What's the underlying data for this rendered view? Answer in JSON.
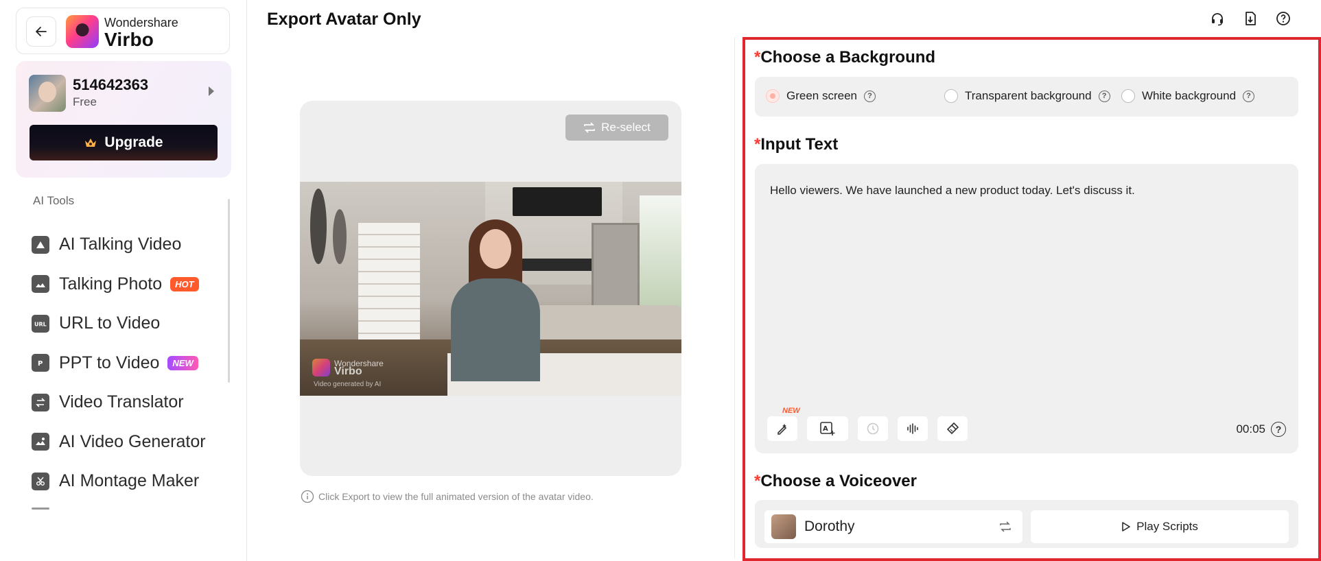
{
  "app": {
    "brand_small": "Wondershare",
    "brand_big": "Virbo",
    "accent_color": "#ff3b30",
    "highlight_border_color": "#e0262e"
  },
  "account": {
    "id": "514642363",
    "plan": "Free",
    "upgrade_label": "Upgrade"
  },
  "sidebar": {
    "section_title": "AI Tools",
    "items": [
      {
        "label": "AI Talking Video",
        "icon": "play-triangle-icon"
      },
      {
        "label": "Talking Photo",
        "icon": "photo-icon",
        "badge": "HOT"
      },
      {
        "label": "URL to Video",
        "icon": "url-icon"
      },
      {
        "label": "PPT to Video",
        "icon": "ppt-icon",
        "badge": "NEW"
      },
      {
        "label": "Video Translator",
        "icon": "translate-icon"
      },
      {
        "label": "AI Video Generator",
        "icon": "video-generator-icon"
      },
      {
        "label": "AI Montage Maker",
        "icon": "scissors-icon"
      }
    ]
  },
  "header": {
    "title": "Export Avatar Only",
    "icons": [
      "headset-icon",
      "export-file-icon",
      "help-icon"
    ]
  },
  "preview": {
    "reselect_label": "Re-select",
    "watermark_brand_small": "Wondershare",
    "watermark_brand_big": "Virbo",
    "watermark_sub": "Video generated by AI",
    "note": "Click Export to view the full animated version of the avatar video."
  },
  "background": {
    "heading": "Choose a Background",
    "options": [
      {
        "label": "Green screen",
        "selected": true
      },
      {
        "label": "Transparent background",
        "selected": false
      },
      {
        "label": "White background",
        "selected": false
      }
    ]
  },
  "input_text": {
    "heading": "Input Text",
    "value": "Hello viewers. We have launched a new product today. Let's discuss it.",
    "new_tag": "NEW",
    "tools": [
      "ai-write-icon",
      "text-to-image-icon",
      "pause-timer-icon",
      "audio-wave-icon",
      "clear-brush-icon"
    ],
    "duration": "00:05"
  },
  "voiceover": {
    "heading": "Choose a Voiceover",
    "voice_name": "Dorothy",
    "play_label": "Play Scripts"
  }
}
